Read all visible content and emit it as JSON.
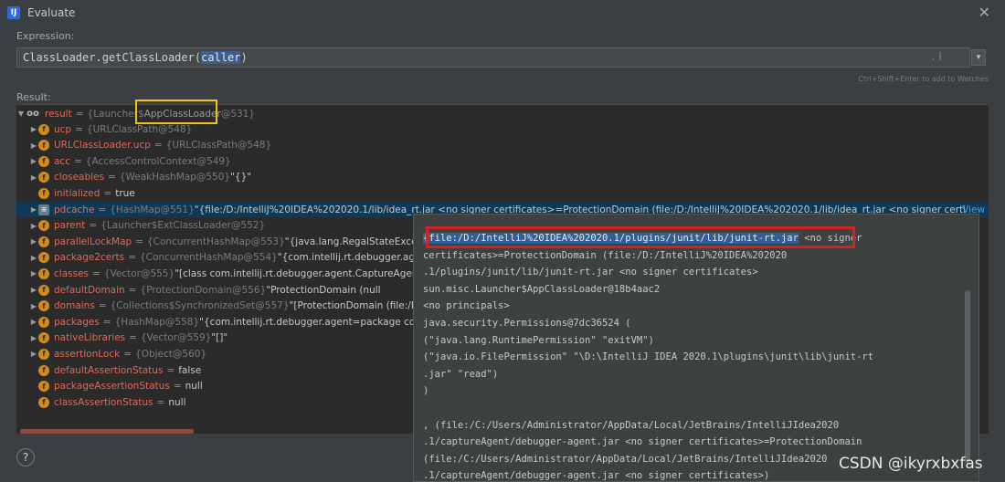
{
  "window": {
    "app_icon": "IJ",
    "title": "Evaluate",
    "close": "✕"
  },
  "expression": {
    "label": "Expression:",
    "prefix": "ClassLoader.getClassLoader(",
    "highlight": "caller",
    "suffix": ")",
    "dots": ". ⁞",
    "dropdown": "▾"
  },
  "hint": "Ctrl+Shift+Enter to add to Watches",
  "result": {
    "label": "Result:",
    "root": {
      "prefix": "oo",
      "name": "result",
      "type": "{Launcher$",
      "highlight": "AppClassLoader",
      "suffix": "@531}"
    },
    "rows": [
      {
        "toggle": "▶",
        "icon": "f",
        "name": "ucp",
        "type": "{URLClassPath@548}",
        "value": ""
      },
      {
        "toggle": "▶",
        "icon": "f",
        "name": "URLClassLoader.ucp",
        "type": "{URLClassPath@548}",
        "value": ""
      },
      {
        "toggle": "▶",
        "icon": "f",
        "name": "acc",
        "type": "{AccessControlContext@549}",
        "value": ""
      },
      {
        "toggle": "▶",
        "icon": "f",
        "name": "closeables",
        "type": "{WeakHashMap@550}",
        "value": "\"{}\""
      },
      {
        "toggle": "",
        "icon": "f",
        "name": "initialized",
        "type": "",
        "value": "true"
      },
      {
        "toggle": "▶",
        "icon": "≡",
        "name": "pdcache",
        "type": "{HashMap@551}",
        "value": "\"{file:/D:/IntelliJ%20IDEA%202020.1/lib/idea_rt.jar <no signer certificates>=ProtectionDomain  (file:/D:/IntelliJ%20IDEA%202020.1/lib/idea_rt.jar <no signer certi",
        "suffix": "View"
      },
      {
        "toggle": "▶",
        "icon": "f",
        "name": "parent",
        "type": "{Launcher$ExtClassLoader@552}",
        "value": ""
      },
      {
        "toggle": "▶",
        "icon": "f",
        "name": "parallelLockMap",
        "type": "{ConcurrentHashMap@553}",
        "value": "\"{java.lang.RegalStateExce"
      },
      {
        "toggle": "▶",
        "icon": "f",
        "name": "package2certs",
        "type": "{ConcurrentHashMap@554}",
        "value": "\"{com.intellij.rt.debugger.ag"
      },
      {
        "toggle": "▶",
        "icon": "f",
        "name": "classes",
        "type": "{Vector@555}",
        "value": "\"[class com.intellij.rt.debugger.agent.CaptureAgen"
      },
      {
        "toggle": "▶",
        "icon": "f",
        "name": "defaultDomain",
        "type": "{ProtectionDomain@556}",
        "value": "\"ProtectionDomain  (null"
      },
      {
        "toggle": "▶",
        "icon": "f",
        "name": "domains",
        "type": "{Collections$SynchronizedSet@557}",
        "value": "\"[ProtectionDomain  (file:/D"
      },
      {
        "toggle": "▶",
        "icon": "f",
        "name": "packages",
        "type": "{HashMap@558}",
        "value": "\"{com.intellij.rt.debugger.agent=package co"
      },
      {
        "toggle": "▶",
        "icon": "f",
        "name": "nativeLibraries",
        "type": "{Vector@559}",
        "value": "\"[]\""
      },
      {
        "toggle": "▶",
        "icon": "f",
        "name": "assertionLock",
        "type": "{Object@560}",
        "value": ""
      },
      {
        "toggle": "",
        "icon": "f",
        "name": "defaultAssertionStatus",
        "type": "",
        "value": "false"
      },
      {
        "toggle": "",
        "icon": "f",
        "name": "packageAssertionStatus",
        "type": "",
        "value": "null"
      },
      {
        "toggle": "",
        "icon": "f",
        "name": "classAssertionStatus",
        "type": "",
        "value": "null"
      }
    ]
  },
  "tooltip": {
    "lines": [
      {
        "highlight": "{file:/D:/IntelliJ%20IDEA%202020.1/plugins/junit/lib/junit-rt.jar",
        "rest": " <no signer"
      },
      {
        "highlight": "",
        "rest": "certificates>=ProtectionDomain  (file:/D:/IntelliJ%20IDEA%202020"
      },
      {
        "highlight": "",
        "rest": ".1/plugins/junit/lib/junit-rt.jar <no signer certificates>"
      },
      {
        "highlight": "",
        "rest": "sun.misc.Launcher$AppClassLoader@18b4aac2"
      },
      {
        "highlight": "",
        "rest": "<no principals>"
      },
      {
        "highlight": "",
        "rest": "java.security.Permissions@7dc36524 ("
      },
      {
        "highlight": "",
        "rest": "(\"java.lang.RuntimePermission\" \"exitVM\")"
      },
      {
        "highlight": "",
        "rest": "(\"java.io.FilePermission\" \"\\D:\\IntelliJ IDEA 2020.1\\plugins\\junit\\lib\\junit-rt"
      },
      {
        "highlight": "",
        "rest": ".jar\" \"read\")"
      },
      {
        "highlight": "",
        "rest": ")"
      },
      {
        "highlight": "",
        "rest": ""
      },
      {
        "highlight": "",
        "rest": ", (file:/C:/Users/Administrator/AppData/Local/JetBrains/IntelliJIdea2020"
      },
      {
        "highlight": "",
        "rest": ".1/captureAgent/debugger-agent.jar <no signer certificates>=ProtectionDomain"
      },
      {
        "highlight": "",
        "rest": "(file:/C:/Users/Administrator/AppData/Local/JetBrains/IntelliJIdea2020"
      },
      {
        "highlight": "",
        "rest": ".1/captureAgent/debugger-agent.jar <no signer certificates>)"
      }
    ]
  },
  "help": "?",
  "watermark": "CSDN @ikyrxbxfas"
}
